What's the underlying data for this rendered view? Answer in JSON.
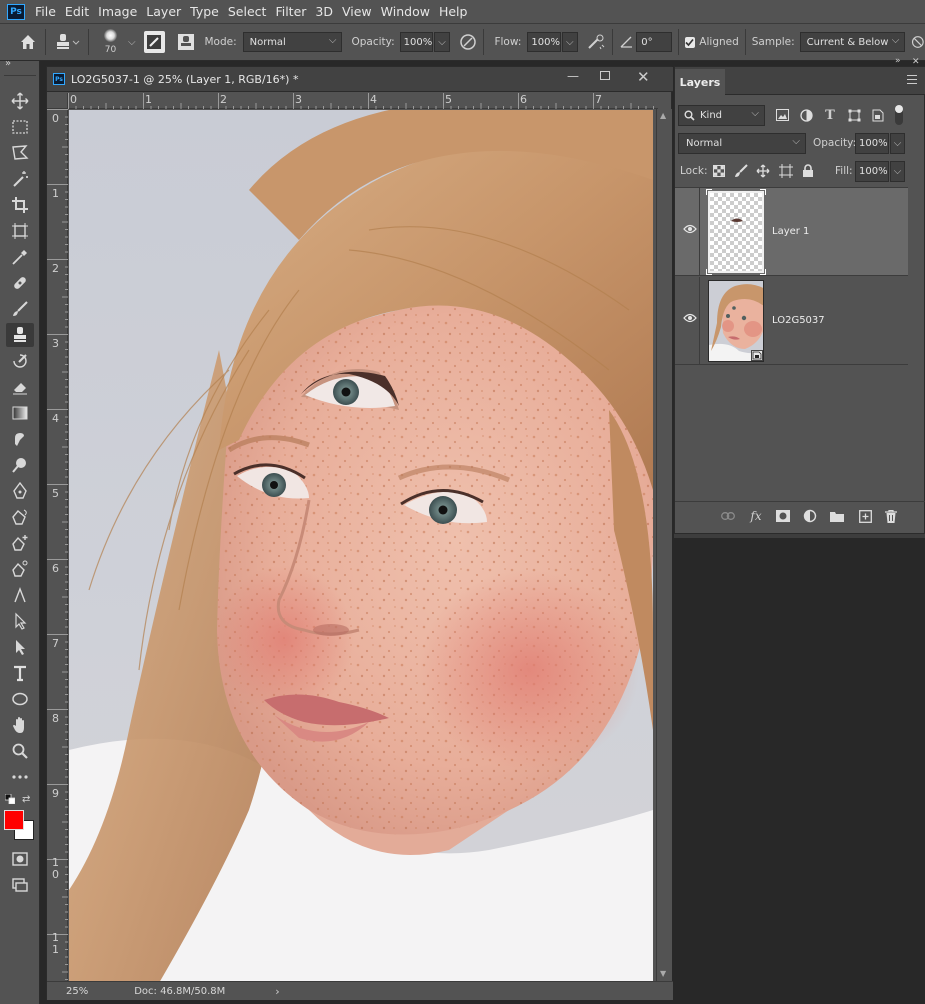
{
  "app": {
    "logo": "Ps"
  },
  "menu": [
    "File",
    "Edit",
    "Image",
    "Layer",
    "Type",
    "Select",
    "Filter",
    "3D",
    "View",
    "Window",
    "Help"
  ],
  "options": {
    "brush_size": "70",
    "mode_label": "Mode:",
    "mode_value": "Normal",
    "opacity_label": "Opacity:",
    "opacity_value": "100%",
    "flow_label": "Flow:",
    "flow_value": "100%",
    "angle_value": "0°",
    "aligned_label": "Aligned",
    "aligned_checked": true,
    "sample_label": "Sample:",
    "sample_value": "Current & Below"
  },
  "document": {
    "tab_title": "LO2G5037-1 @ 25% (Layer 1, RGB/16*) *",
    "ruler_h": [
      "0",
      "1",
      "2",
      "3",
      "4",
      "5",
      "6",
      "7"
    ],
    "ruler_v": [
      "0",
      "1",
      "2",
      "3",
      "4",
      "5",
      "6",
      "7",
      "8",
      "9",
      "1\n0",
      "1\n1"
    ],
    "zoom": "25%",
    "doc_size": "Doc: 46.8M/50.8M"
  },
  "colors": {
    "foreground": "#ff0000",
    "background": "#ffffff",
    "accent": "#31a8ff"
  },
  "layers_panel": {
    "title": "Layers",
    "filter_kind": "Kind",
    "blend_mode": "Normal",
    "opacity_label": "Opacity:",
    "opacity_value": "100%",
    "lock_label": "Lock:",
    "fill_label": "Fill:",
    "fill_value": "100%",
    "layers": [
      {
        "name": "Layer 1",
        "visible": true,
        "selected": true
      },
      {
        "name": "LO2G5037",
        "visible": true,
        "selected": false
      }
    ]
  }
}
